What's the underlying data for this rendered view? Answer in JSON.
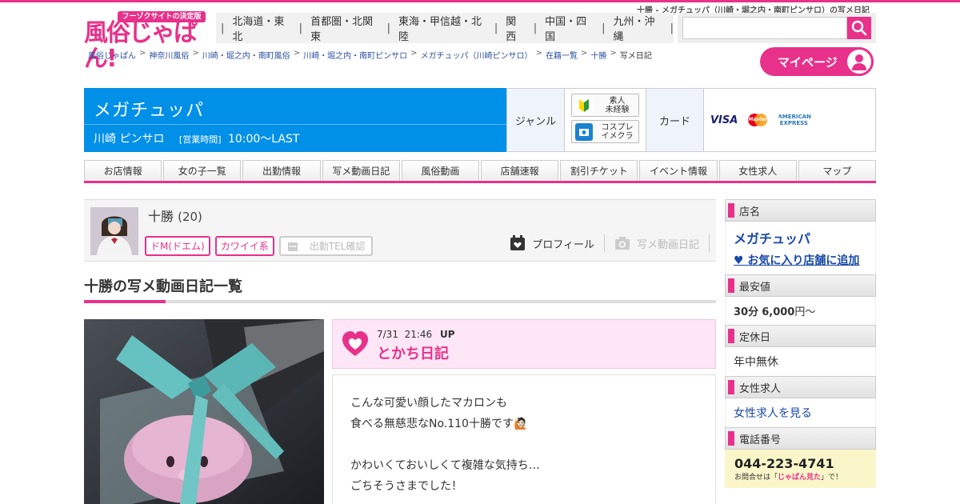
{
  "page_title": "十勝 - メガチュッパ（川崎・堀之内・南町ピンサロ）の写メ日記",
  "logo": {
    "tagline": "フーゾクサイトの決定版",
    "name": "風俗じゃぱん!"
  },
  "regions": [
    "北海道・東北",
    "首都圏・北関東",
    "東海・甲信越・北陸",
    "関西",
    "中国・四国",
    "九州・沖縄"
  ],
  "search": {
    "value": ""
  },
  "breadcrumbs": [
    "風俗じゃぱん",
    "神奈川風俗",
    "川崎・堀之内・南町風俗",
    "川崎・堀之内・南町ピンサロ",
    "メガチュッパ（川崎ピンサロ）",
    "在籍一覧",
    "十勝"
  ],
  "breadcrumb_current": "写メ日記",
  "mypage_label": "マイページ",
  "shop": {
    "name": "メガチュッパ",
    "area": "川崎 ピンサロ",
    "hours_label": "[営業時間]",
    "hours": "10:00～LAST"
  },
  "info": {
    "genre_label": "ジャンル",
    "genres": [
      {
        "line1": "素人",
        "line2": "未経験",
        "icon": "beginner-mark-icon"
      },
      {
        "line1": "コスプレ",
        "line2": "イメクラ",
        "icon": "cosplay-icon"
      }
    ],
    "card_label": "カード",
    "cards": [
      "VISA",
      "MasterCard",
      "AMERICAN EXPRESS"
    ]
  },
  "nav": [
    "お店情報",
    "女の子一覧",
    "出勤情報",
    "写メ動画日記",
    "風俗動画",
    "店舗速報",
    "割引チケット",
    "イベント情報",
    "女性求人",
    "マップ"
  ],
  "girl": {
    "name": "十勝",
    "age": "(20)",
    "tags": [
      "ドM(ドエム)",
      "カワイイ系"
    ],
    "tel_tag": "出勤TEL確認",
    "profile_label": "プロフィール",
    "diary_label": "写メ動画日記"
  },
  "section_title": "十勝の写メ動画日記一覧",
  "entry": {
    "date": "7/31",
    "time": "21:46",
    "up": "UP",
    "title": "とかち日記",
    "body": [
      "こんな可愛い顔したマカロンも",
      "食べる無慈悲なNo.110十勝です🙋🏻",
      "",
      "かわいくておいしくて複雑な気持ち…",
      "ごちそうさまでした！"
    ]
  },
  "sidebar": {
    "shop_label": "店名",
    "shop_name": "メガチュッパ",
    "fav_link": "♥ お気に入り店舗に追加",
    "price_label": "最安値",
    "price_min": "30分",
    "price_amount": "6,000",
    "price_suffix": "円～",
    "holiday_label": "定休日",
    "holiday": "年中無休",
    "jobs_label": "女性求人",
    "jobs_link": "女性求人を見る",
    "tel_label": "電話番号",
    "tel": "044-223-4741",
    "tel_note_pre": "お問合せは「",
    "tel_note_em": "じゃぱん見た",
    "tel_note_post": "」で！"
  },
  "colors": {
    "accent": "#e8318b",
    "shop_bar": "#0090e8",
    "link": "#1848a8"
  }
}
